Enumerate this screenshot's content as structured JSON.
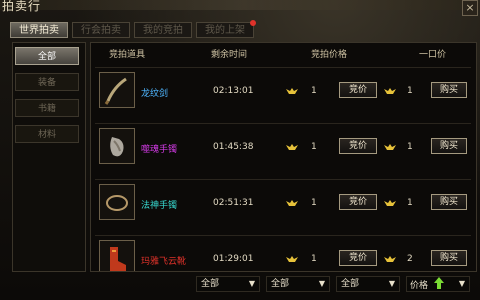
{
  "window": {
    "title": "拍卖行",
    "close_glyph": "×"
  },
  "tabs": [
    {
      "label": "世界拍卖",
      "active": true
    },
    {
      "label": "行会拍卖",
      "active": false
    },
    {
      "label": "我的竞拍",
      "active": false
    },
    {
      "label": "我的上架",
      "active": false,
      "notify": true
    }
  ],
  "categories": [
    {
      "label": "全部",
      "active": true
    },
    {
      "label": "装备",
      "active": false
    },
    {
      "label": "书籍",
      "active": false
    },
    {
      "label": "材料",
      "active": false
    }
  ],
  "columns": {
    "item": "竞拍道具",
    "time": "剩余时间",
    "bid_price": "竞拍价格",
    "buyout": "一口价"
  },
  "rows": [
    {
      "name": "龙纹剑",
      "name_color": "#4fb6ff",
      "time": "02:13:01",
      "bid": "1",
      "buyout": "1",
      "bid_label": "竞价",
      "buy_label": "购买",
      "icon": "dragon-sword-icon"
    },
    {
      "name": "噬魂手镯",
      "name_color": "#d43be6",
      "time": "01:45:38",
      "bid": "1",
      "buyout": "1",
      "bid_label": "竞价",
      "buy_label": "购买",
      "icon": "bracelet-icon"
    },
    {
      "name": "法神手镯",
      "name_color": "#38d9d0",
      "time": "02:51:31",
      "bid": "1",
      "buyout": "1",
      "bid_label": "竞价",
      "buy_label": "购买",
      "icon": "ring-icon"
    },
    {
      "name": "玛雅飞云靴",
      "name_color": "#e0322a",
      "time": "01:29:01",
      "bid": "1",
      "buyout": "2",
      "bid_label": "竞价",
      "buy_label": "购买",
      "icon": "boots-icon"
    }
  ],
  "filters": [
    {
      "value": "全部"
    },
    {
      "value": "全部"
    },
    {
      "value": "全部"
    }
  ],
  "sort": {
    "label": "价格"
  },
  "colors": {
    "gold_ingot": "#e7c23a",
    "accent_green": "#7bdc35"
  }
}
